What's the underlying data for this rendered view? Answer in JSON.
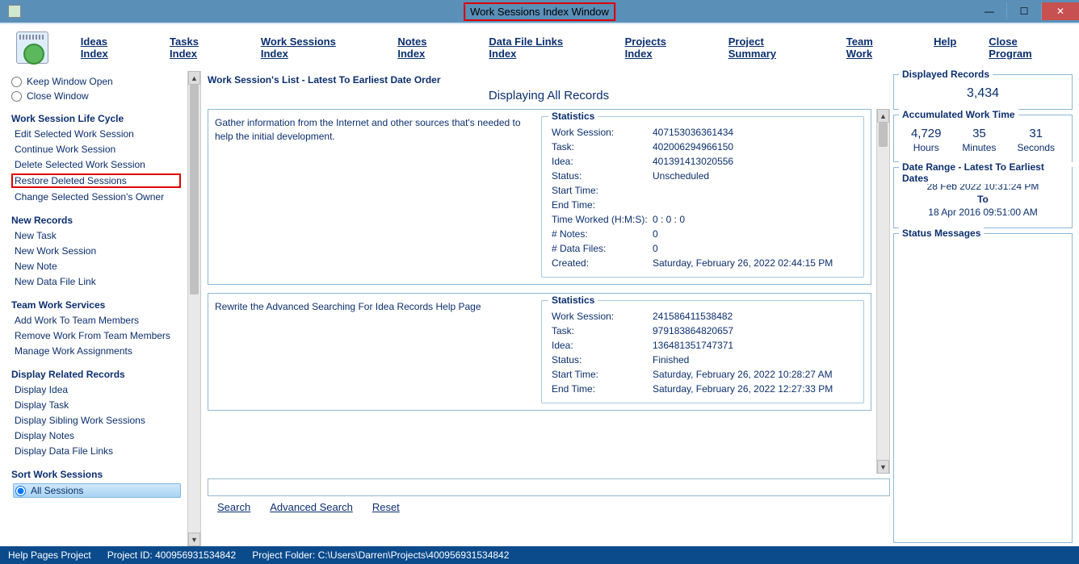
{
  "title": "Work Sessions Index Window",
  "toolbar": [
    "Ideas Index",
    "Tasks Index",
    "Work Sessions Index",
    "Notes Index",
    "Data File Links Index",
    "Projects Index",
    "Project Summary",
    "Team Work",
    "Help",
    "Close Program"
  ],
  "toolbar_underline_idx": [
    0,
    0,
    0,
    0,
    0,
    0,
    8,
    0,
    0,
    0
  ],
  "sidebar": {
    "keep_open": "Keep Window Open",
    "close": "Close Window",
    "groups": [
      {
        "h": "Work Session Life Cycle",
        "items": [
          "Edit Selected Work Session",
          "Continue Work Session",
          "Delete Selected Work Session",
          "Restore Deleted Sessions",
          "Change Selected Session's Owner"
        ],
        "highlight_idx": 3
      },
      {
        "h": "New Records",
        "items": [
          "New Task",
          "New Work Session",
          "New Note",
          "New Data File Link"
        ]
      },
      {
        "h": "Team Work Services",
        "items": [
          "Add Work To Team Members",
          "Remove Work From Team Members",
          "Manage Work Assignments"
        ]
      },
      {
        "h": "Display Related Records",
        "items": [
          "Display Idea",
          "Display Task",
          "Display Sibling Work Sessions",
          "Display Notes",
          "Display Data File Links"
        ]
      },
      {
        "h": "Sort Work Sessions",
        "items": [
          "All Sessions"
        ],
        "selected_idx": 0,
        "radio": true
      }
    ]
  },
  "list_label": "Work Session's List - Latest To Earliest Date Order",
  "display_all": "Displaying All Records",
  "records": [
    {
      "desc": "Gather information from the Internet and other sources that's needed to help the initial development.",
      "stats": {
        "work_session": "407153036361434",
        "task": "402006294966150",
        "idea": "401391413020556",
        "status": "Unscheduled",
        "start": "",
        "end": "",
        "time_worked": "0  :  0  :  0",
        "notes": "0",
        "datafiles": "0",
        "created": "Saturday, February 26, 2022   02:44:15 PM"
      }
    },
    {
      "desc": "Rewrite the Advanced Searching For Idea Records Help Page",
      "stats": {
        "work_session": "241586411538482",
        "task": "979183864820657",
        "idea": "136481351747371",
        "status": "Finished",
        "start": "Saturday, February 26, 2022   10:28:27 AM",
        "end": "Saturday, February 26, 2022   12:27:33 PM",
        "time_worked": "",
        "notes": "",
        "datafiles": "",
        "created": ""
      }
    }
  ],
  "stat_labels": {
    "ws": "Work Session:",
    "task": "Task:",
    "idea": "Idea:",
    "status": "Status:",
    "start": "Start Time:",
    "end": "End Time:",
    "tw": "Time Worked (H:M:S):",
    "notes": "# Notes:",
    "df": "# Data Files:",
    "created": "Created:"
  },
  "search": {
    "search": "Search",
    "adv": "Advanced Search",
    "reset": "Reset"
  },
  "right": {
    "displayed_h": "Displayed Records",
    "displayed": "3,434",
    "accum_h": "Accumulated Work Time",
    "hours": "4,729",
    "minutes": "35",
    "seconds": "31",
    "hours_l": "Hours",
    "minutes_l": "Minutes",
    "seconds_l": "Seconds",
    "range_h": "Date Range - Latest To Earliest Dates",
    "range_latest": "28 Feb 2022  10:31:24 PM",
    "range_to": "To",
    "range_earliest": "18 Apr 2016  09:51:00 AM",
    "status_h": "Status Messages"
  },
  "statusbar": {
    "proj": "Help Pages Project",
    "pid_l": "Project ID:",
    "pid": "400956931534842",
    "pf_l": "Project Folder:",
    "pf": "C:\\Users\\Darren\\Projects\\400956931534842"
  }
}
